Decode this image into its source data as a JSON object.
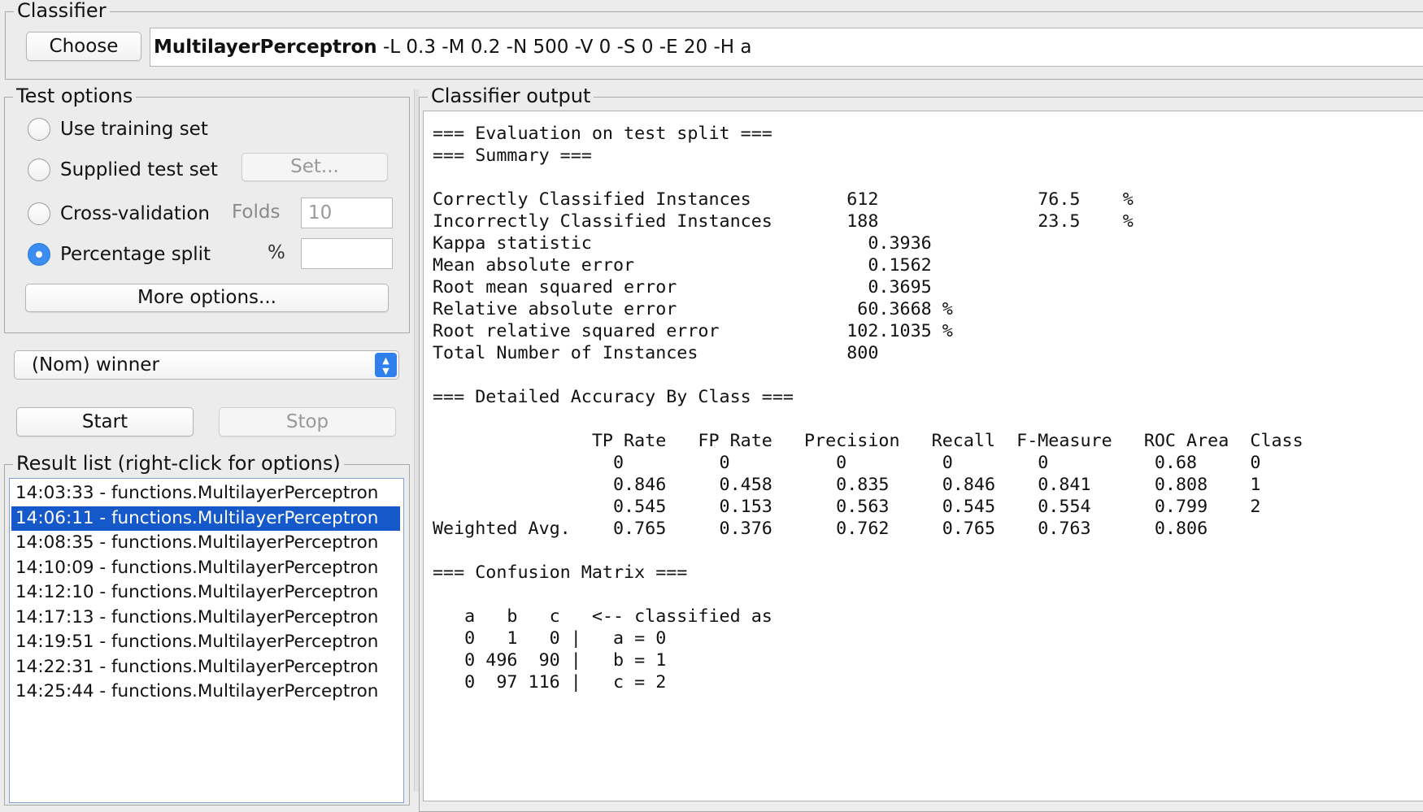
{
  "classifier": {
    "group_title": "Classifier",
    "choose_label": "Choose",
    "name": "MultilayerPerceptron",
    "options": " -L 0.3 -M 0.2 -N 500 -V 0 -S 0 -E 20 -H a"
  },
  "test_options": {
    "title": "Test options",
    "use_training_set": "Use training set",
    "supplied_test_set": "Supplied test set",
    "set_button": "Set...",
    "cross_validation": "Cross-validation",
    "folds_label": "Folds",
    "folds_value": "10",
    "percentage_split": "Percentage split",
    "percent_symbol": "%",
    "percent_value": "",
    "selected": "percentage_split",
    "more_options": "More options..."
  },
  "class_select": {
    "value": "(Nom) winner"
  },
  "controls": {
    "start": "Start",
    "stop": "Stop"
  },
  "result_list": {
    "title": "Result list (right-click for options)",
    "items": [
      "14:03:33 - functions.MultilayerPerceptron",
      "14:06:11 - functions.MultilayerPerceptron",
      "14:08:35 - functions.MultilayerPerceptron",
      "14:10:09 - functions.MultilayerPerceptron",
      "14:12:10 - functions.MultilayerPerceptron",
      "14:17:13 - functions.MultilayerPerceptron",
      "14:19:51 - functions.MultilayerPerceptron",
      "14:22:31 - functions.MultilayerPerceptron",
      "14:25:44 - functions.MultilayerPerceptron"
    ],
    "selected_index": 1
  },
  "output": {
    "title": "Classifier output",
    "lines": [
      "=== Evaluation on test split ===",
      "=== Summary ===",
      "",
      "Correctly Classified Instances         612               76.5    %",
      "Incorrectly Classified Instances       188               23.5    %",
      "Kappa statistic                          0.3936",
      "Mean absolute error                      0.1562",
      "Root mean squared error                  0.3695",
      "Relative absolute error                 60.3668 %",
      "Root relative squared error            102.1035 %",
      "Total Number of Instances              800",
      "",
      "=== Detailed Accuracy By Class ===",
      "",
      "               TP Rate   FP Rate   Precision   Recall  F-Measure   ROC Area  Class",
      "                 0         0          0         0        0          0.68     0",
      "                 0.846     0.458      0.835     0.846    0.841      0.808    1",
      "                 0.545     0.153      0.563     0.545    0.554      0.799    2",
      "Weighted Avg.    0.765     0.376      0.762     0.765    0.763      0.806",
      "",
      "=== Confusion Matrix ===",
      "",
      "   a   b   c   <-- classified as",
      "   0   1   0 |   a = 0",
      "   0 496  90 |   b = 1",
      "   0  97 116 |   c = 2"
    ]
  },
  "colors": {
    "selection": "#1458c9",
    "radio_selected": "#3b8df2",
    "background": "#ececec"
  }
}
